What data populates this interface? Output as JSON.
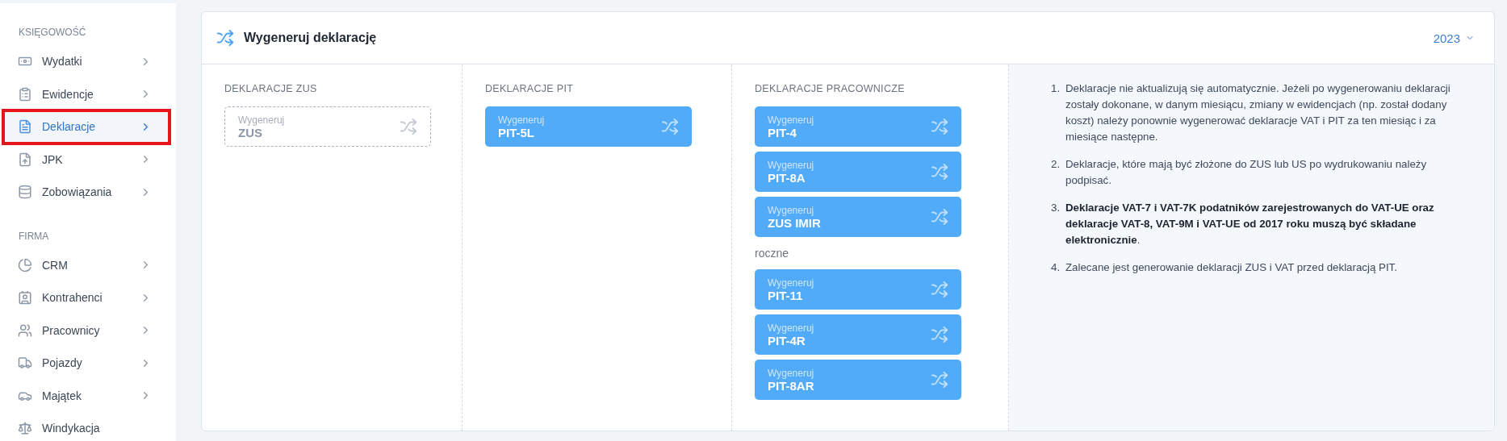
{
  "sidebar": {
    "sections": [
      {
        "title": "KSIĘGOWOŚĆ",
        "items": [
          {
            "label": "Wydatki",
            "selected": false,
            "chevron": true
          },
          {
            "label": "Ewidencje",
            "selected": false,
            "chevron": true
          },
          {
            "label": "Deklaracje",
            "selected": true,
            "chevron": true
          },
          {
            "label": "JPK",
            "selected": false,
            "chevron": true
          },
          {
            "label": "Zobowiązania",
            "selected": false,
            "chevron": true
          }
        ]
      },
      {
        "title": "FIRMA",
        "items": [
          {
            "label": "CRM",
            "selected": false,
            "chevron": true
          },
          {
            "label": "Kontrahenci",
            "selected": false,
            "chevron": true
          },
          {
            "label": "Pracownicy",
            "selected": false,
            "chevron": true
          },
          {
            "label": "Pojazdy",
            "selected": false,
            "chevron": true
          },
          {
            "label": "Majątek",
            "selected": false,
            "chevron": true
          },
          {
            "label": "Windykacja",
            "selected": false,
            "chevron": false
          }
        ]
      }
    ]
  },
  "card": {
    "title": "Wygeneruj deklarację",
    "year": "2023",
    "columns": [
      {
        "title": "DEKLARACJE ZUS",
        "groups": [
          {
            "buttons": [
              {
                "caption": "Wygeneruj",
                "name": "ZUS",
                "disabled": true
              }
            ]
          }
        ]
      },
      {
        "title": "DEKLARACJE PIT",
        "groups": [
          {
            "buttons": [
              {
                "caption": "Wygeneruj",
                "name": "PIT-5L",
                "disabled": false
              }
            ]
          }
        ]
      },
      {
        "title": "DEKLARACJE PRACOWNICZE",
        "groups": [
          {
            "buttons": [
              {
                "caption": "Wygeneruj",
                "name": "PIT-4",
                "disabled": false
              },
              {
                "caption": "Wygeneruj",
                "name": "PIT-8A",
                "disabled": false
              },
              {
                "caption": "Wygeneruj",
                "name": "ZUS IMIR",
                "disabled": false
              }
            ]
          },
          {
            "subtitle": "roczne",
            "buttons": [
              {
                "caption": "Wygeneruj",
                "name": "PIT-11",
                "disabled": false
              },
              {
                "caption": "Wygeneruj",
                "name": "PIT-4R",
                "disabled": false
              },
              {
                "caption": "Wygeneruj",
                "name": "PIT-8AR",
                "disabled": false
              }
            ]
          }
        ]
      }
    ],
    "notes": [
      {
        "number": "1.",
        "text": "Deklaracje nie aktualizują się automatycznie. Jeżeli po wygenerowaniu deklaracji zostały dokonane, w danym miesiącu, zmiany w ewidencjach (np. został dodany koszt) należy ponownie wygenerować deklaracje VAT i PIT za ten miesiąc i za miesiące następne."
      },
      {
        "number": "2.",
        "text": "Deklaracje, które mają być złożone do ZUS lub US po wydrukowaniu należy podpisać."
      },
      {
        "number": "3.",
        "text": "**Deklaracje VAT-7 i VAT-7K podatników zarejestrowanych do VAT-UE oraz deklaracje VAT-8, VAT-9M i VAT-UE od 2017 roku muszą być składane elektronicznie**."
      },
      {
        "number": "4.",
        "text": "Zalecane jest generowanie deklaracji ZUS i VAT przed deklaracją PIT."
      }
    ]
  }
}
